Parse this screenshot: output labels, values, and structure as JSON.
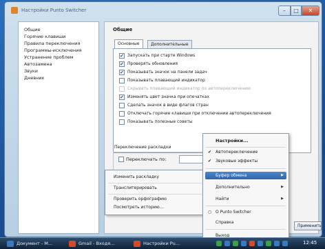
{
  "window": {
    "title": "Настройки Punto Switcher",
    "minimize_icon": "minimize-icon",
    "maximize_icon": "maximize-icon",
    "close_icon": "close-icon"
  },
  "sidebar": {
    "items": [
      {
        "label": "Общие"
      },
      {
        "label": "Горячие клавиши"
      },
      {
        "label": "Правила переключения"
      },
      {
        "label": "Программы-исключения"
      },
      {
        "label": "Устранение проблем"
      },
      {
        "label": "Автозамена"
      },
      {
        "label": "Звуки"
      },
      {
        "label": "Дневник"
      }
    ]
  },
  "main": {
    "title": "Общие",
    "tabs": [
      {
        "label": "Основные",
        "active": true
      },
      {
        "label": "Дополнительные",
        "active": false
      }
    ],
    "options": [
      {
        "label": "Запускать при старте Windows",
        "checked": true,
        "enabled": true
      },
      {
        "label": "Проверять обновления",
        "checked": true,
        "enabled": true
      },
      {
        "label": "Показывать значок на панели задач",
        "checked": true,
        "enabled": true
      },
      {
        "label": "Показывать плавающий индикатор",
        "checked": false,
        "enabled": true
      },
      {
        "label": "Скрывать плавающий индикатор по автопереключению",
        "checked": false,
        "enabled": false
      },
      {
        "label": "Изменять цвет значка при опечатках",
        "checked": true,
        "enabled": true
      },
      {
        "label": "Сделать значок в виде флагов стран",
        "checked": false,
        "enabled": true
      },
      {
        "label": "Отключать горячие клавиши при отключении автопереключения",
        "checked": false,
        "enabled": true
      },
      {
        "label": "Показывать полезные советы",
        "checked": false,
        "enabled": true
      }
    ],
    "switch_section_label": "Переключение раскладки",
    "switch_row_label": "Переключать по:",
    "apply_label": "Применить"
  },
  "submenu": {
    "items": [
      "Изменить раскладку",
      "Транслитерировать",
      "Проверить орфографию",
      "Посмотреть историю..."
    ]
  },
  "context_menu": {
    "settings": "Настройки...",
    "auto_switch": "Автопереключение",
    "sound_effects": "Звуковые эффекты",
    "clipboard": "Буфер обмена",
    "extra": "Дополнительно",
    "find": "Найти",
    "about": "О Punto Switcher",
    "help": "Справка",
    "exit": "Выход",
    "check_glyph": "✔",
    "arrow_glyph": "▶",
    "radio_glyph": "○"
  },
  "taskbar": {
    "items": [
      {
        "label": "Документ - М...",
        "icon": "window-icon"
      },
      {
        "label": "Gmail - Входя...",
        "icon": "browser-icon"
      },
      {
        "label": "Настройки Pu...",
        "icon": "settings-icon"
      }
    ],
    "clock": "12:45",
    "colors": {
      "icon_red": "#d64a2a",
      "icon_blue": "#3a78c2",
      "icon_green": "#3aa04a"
    }
  }
}
